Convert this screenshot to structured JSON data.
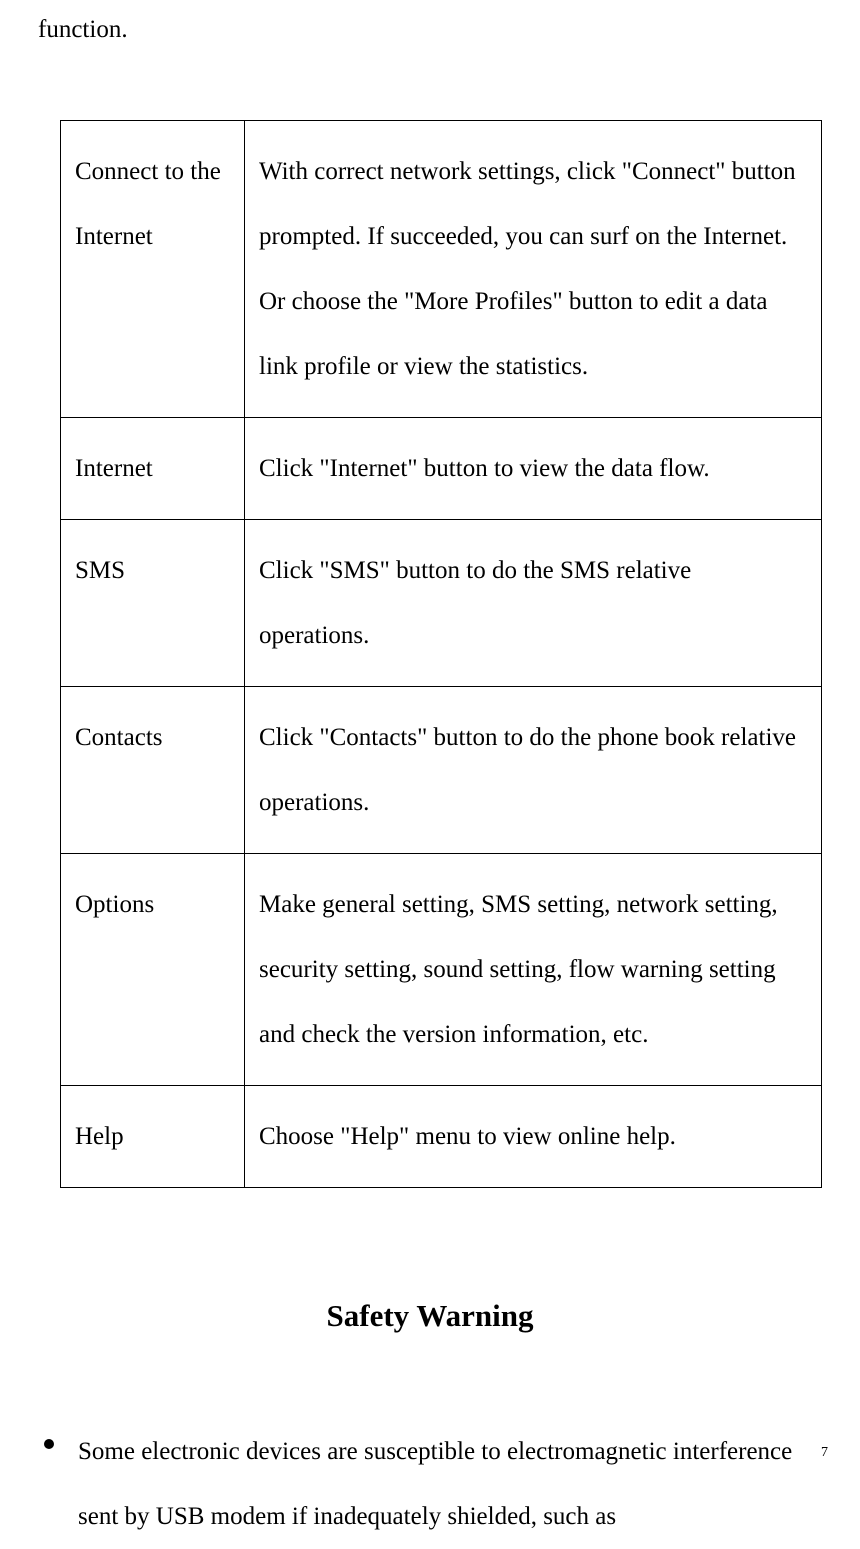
{
  "intro": "function.",
  "table": {
    "rows": [
      {
        "label": "Connect to the Internet",
        "desc": "With correct network settings, click \"Connect\" button prompted. If succeeded, you can surf on the Internet. Or choose the \"More Profiles\" button to edit a data link profile or view the statistics."
      },
      {
        "label": "Internet",
        "desc": "Click \"Internet\" button to view the data flow."
      },
      {
        "label": "SMS",
        "desc": "Click \"SMS\" button to do the SMS relative operations."
      },
      {
        "label": "Contacts",
        "desc": "Click \"Contacts\" button to do the phone book relative operations."
      },
      {
        "label": "Options",
        "desc": "Make general setting, SMS setting, network setting, security setting, sound setting, flow warning setting and check the version information, etc."
      },
      {
        "label": "Help",
        "desc": "Choose \"Help\" menu to view online help."
      }
    ]
  },
  "heading": "Safety Warning",
  "bullets": [
    "Some electronic devices are susceptible to electromagnetic interference sent by USB modem if inadequately shielded, such as"
  ],
  "page_number": "7"
}
